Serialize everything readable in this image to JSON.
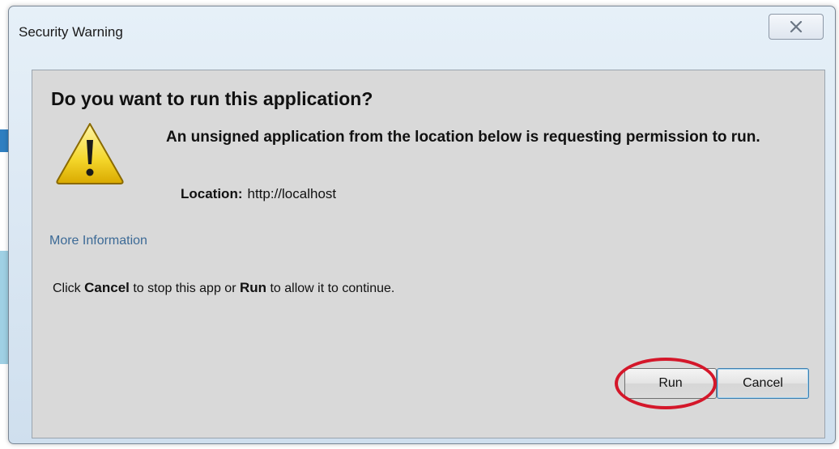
{
  "window": {
    "title": "Security Warning",
    "close_icon": "close-icon"
  },
  "dialog": {
    "heading": "Do you want to run this application?",
    "warning_icon": "warning-icon",
    "message": "An unsigned application from the location below is requesting permission to run.",
    "location_label": "Location:",
    "location_value": "http://localhost",
    "more_information": "More Information",
    "instruction": {
      "prefix": "Click",
      "cancel_word": "Cancel",
      "middle": "to stop this app or",
      "run_word": "Run",
      "suffix": "to allow it to continue."
    }
  },
  "buttons": {
    "run": "Run",
    "cancel": "Cancel"
  },
  "annotation": {
    "highlight": "red-circle-around-run",
    "color": "#d4172a"
  },
  "colors": {
    "link": "#3c6a96",
    "content_bg": "#d9d9d9",
    "frame_bg": "#dde9f4"
  }
}
